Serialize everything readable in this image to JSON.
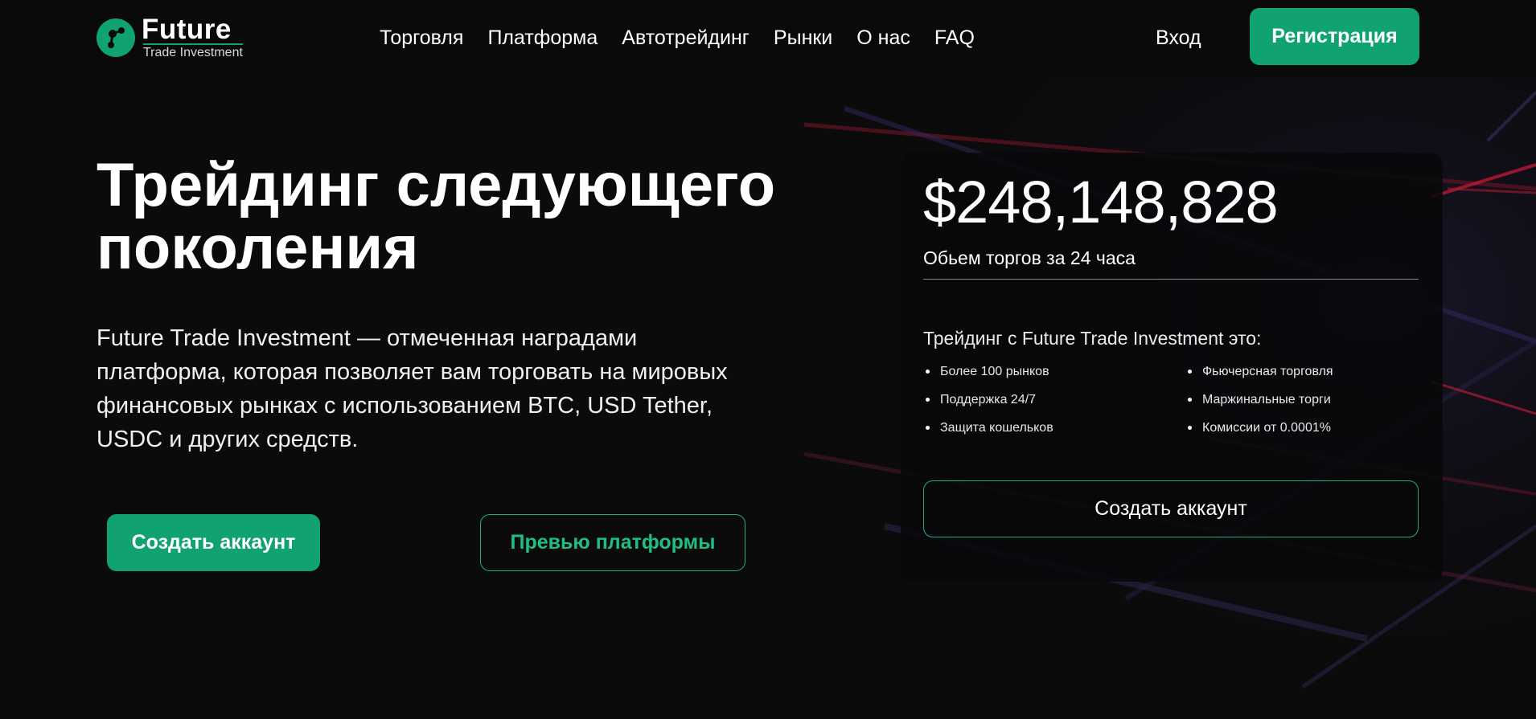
{
  "logo": {
    "title": "Future",
    "subtitle": "Trade Investment"
  },
  "nav": {
    "items": [
      {
        "label": "Торговля"
      },
      {
        "label": "Платформа"
      },
      {
        "label": "Автотрейдинг"
      },
      {
        "label": "Рынки"
      },
      {
        "label": "О нас"
      },
      {
        "label": "FAQ"
      }
    ],
    "login_label": "Вход",
    "register_label": "Регистрация"
  },
  "hero": {
    "title": "Трейдинг следующего поколения",
    "description": "Future Trade Investment — отмеченная наградами платформа, которая позволяет вам торговать на мировых финансовых рынках с использованием BTC, USD Tether, USDC и других средств.",
    "create_account_label": "Создать аккаунт",
    "preview_label": "Превью платформы"
  },
  "stats_card": {
    "volume": "$248,148,828",
    "volume_label": "Обьем торгов за 24 часа",
    "features_title": "Трейдинг с Future Trade Investment это:",
    "features": [
      "Более 100 рынков",
      "Фьючерсная торговля",
      "Поддержка 24/7",
      "Маржинальные торги",
      "Защита кошельков",
      "Комиссии от 0.0001%"
    ],
    "button_label": "Создать аккаунт"
  },
  "colors": {
    "accent": "#10a36f",
    "background": "#0b0b0c"
  }
}
